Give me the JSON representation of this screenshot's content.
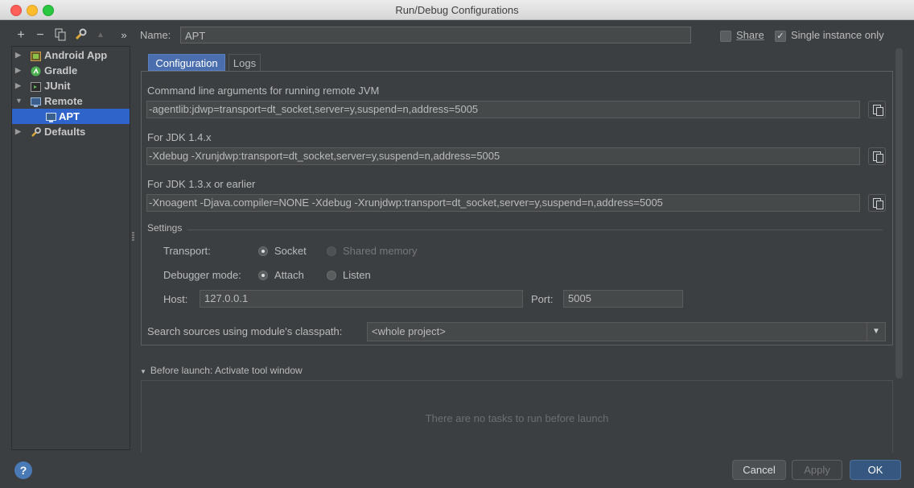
{
  "window": {
    "title": "Run/Debug Configurations"
  },
  "toolbar": {
    "add": "+",
    "remove": "−",
    "more": "»"
  },
  "tree": {
    "items": [
      {
        "label": "Android App",
        "expanded": false
      },
      {
        "label": "Gradle",
        "expanded": false
      },
      {
        "label": "JUnit",
        "expanded": false
      },
      {
        "label": "Remote",
        "expanded": true
      },
      {
        "label": "APT",
        "selected": true
      },
      {
        "label": "Defaults",
        "expanded": false
      }
    ]
  },
  "header": {
    "name_label": "Name:",
    "name_value": "APT",
    "share_label": "Share",
    "share_checked": false,
    "single_instance_label": "Single instance only",
    "single_instance_checked": true
  },
  "tabs": [
    {
      "label": "Configuration",
      "active": true
    },
    {
      "label": "Logs",
      "active": false
    }
  ],
  "config": {
    "cmdline_label": "Command line arguments for running remote JVM",
    "cmdline_value": "-agentlib:jdwp=transport=dt_socket,server=y,suspend=n,address=5005",
    "jdk14_label": "For JDK 1.4.x",
    "jdk14_value": "-Xdebug -Xrunjdwp:transport=dt_socket,server=y,suspend=n,address=5005",
    "jdk13_label": "For JDK 1.3.x or earlier",
    "jdk13_value": "-Xnoagent -Djava.compiler=NONE -Xdebug -Xrunjdwp:transport=dt_socket,server=y,suspend=n,address=5005",
    "settings_label": "Settings",
    "transport_label": "Transport:",
    "transport_options": [
      "Socket",
      "Shared memory"
    ],
    "transport_selected": "Socket",
    "debugger_mode_label": "Debugger mode:",
    "debugger_mode_options": [
      "Attach",
      "Listen"
    ],
    "debugger_mode_selected": "Attach",
    "host_label": "Host:",
    "host_value": "127.0.0.1",
    "port_label": "Port:",
    "port_value": "5005",
    "classpath_label": "Search sources using module's classpath:",
    "classpath_value": "<whole project>"
  },
  "before_launch": {
    "title": "Before launch: Activate tool window",
    "empty_text": "There are no tasks to run before launch"
  },
  "buttons": {
    "help": "?",
    "cancel": "Cancel",
    "apply": "Apply",
    "ok": "OK"
  },
  "colors": {
    "accent": "#4b6eaf",
    "selection": "#2f65ca",
    "background": "#3c3f41",
    "ok_button": "#365880"
  }
}
